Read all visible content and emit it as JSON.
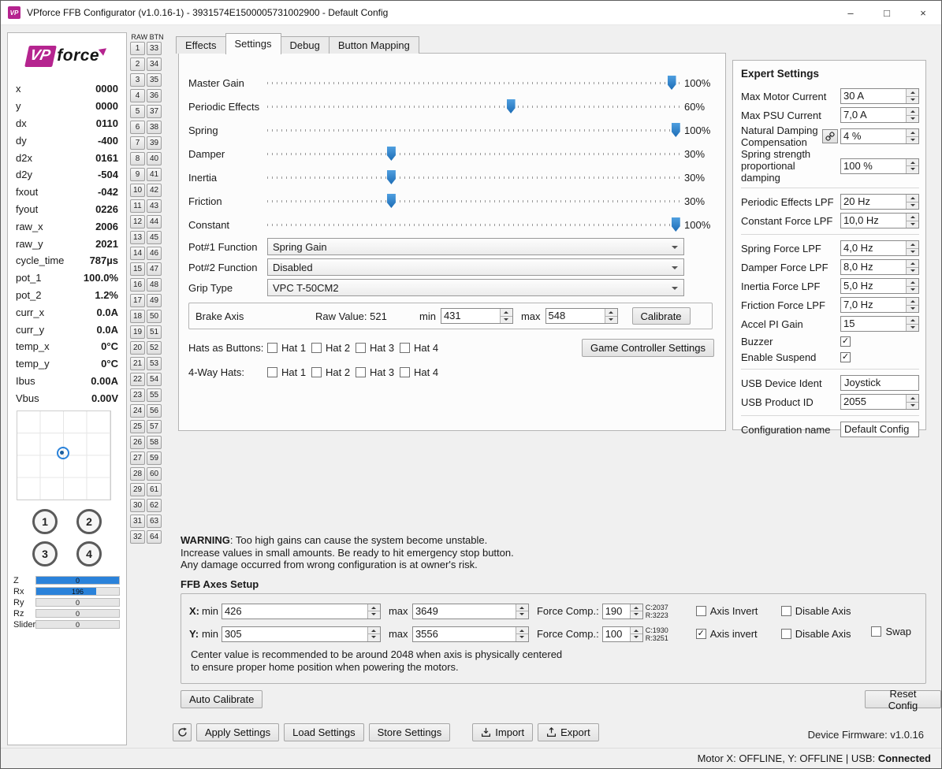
{
  "colors": {
    "accent_blue": "#2a82da",
    "brand_magenta": "#b5248f",
    "slider_handle_blue": "#1c6cb5"
  },
  "window": {
    "icon_text": "VP",
    "title": "VPforce FFB Configurator (v1.0.16-1) - 3931574E1500005731002900 - Default Config",
    "minimize_glyph": "–",
    "maximize_glyph": "□",
    "close_glyph": "×"
  },
  "sidebar": {
    "logo_vp": "VP",
    "logo_force": "force",
    "telemetry": [
      {
        "label": "x",
        "value": "0000"
      },
      {
        "label": "y",
        "value": "0000"
      },
      {
        "label": "dx",
        "value": "0110"
      },
      {
        "label": "dy",
        "value": "-400"
      },
      {
        "label": "d2x",
        "value": "0161"
      },
      {
        "label": "d2y",
        "value": "-504"
      },
      {
        "label": "fxout",
        "value": "-042"
      },
      {
        "label": "fyout",
        "value": "0226"
      },
      {
        "label": "raw_x",
        "value": "2006"
      },
      {
        "label": "raw_y",
        "value": "2021"
      },
      {
        "label": "cycle_time",
        "value": "787µs"
      },
      {
        "label": "pot_1",
        "value": "100.0%"
      },
      {
        "label": "pot_2",
        "value": "1.2%"
      },
      {
        "label": "curr_x",
        "value": "0.0A"
      },
      {
        "label": "curr_y",
        "value": "0.0A"
      },
      {
        "label": "temp_x",
        "value": "0°C"
      },
      {
        "label": "temp_y",
        "value": "0°C"
      },
      {
        "label": "Ibus",
        "value": "0.00A"
      },
      {
        "label": "Vbus",
        "value": "0.00V"
      }
    ],
    "round_buttons": [
      "1",
      "2",
      "3",
      "4"
    ],
    "axis_bars": [
      {
        "label": "Z",
        "value": "0",
        "fill": 100
      },
      {
        "label": "Rx",
        "value": "196",
        "fill": 72
      },
      {
        "label": "Ry",
        "value": "0",
        "fill": 0
      },
      {
        "label": "Rz",
        "value": "0",
        "fill": 0
      },
      {
        "label": "Slider",
        "value": "0",
        "fill": 0
      }
    ]
  },
  "raw_btn": {
    "header": "RAW BTN",
    "rows": 32
  },
  "tabs": [
    {
      "label": "Effects",
      "active": false
    },
    {
      "label": "Settings",
      "active": true
    },
    {
      "label": "Debug",
      "active": false
    },
    {
      "label": "Button Mapping",
      "active": false
    }
  ],
  "settings": {
    "sliders": [
      {
        "label": "Master Gain",
        "value": "100%",
        "pos": 98
      },
      {
        "label": "Periodic Effects",
        "value": "60%",
        "pos": 59
      },
      {
        "label": "Spring",
        "value": "100%",
        "pos": 99
      },
      {
        "label": "Damper",
        "value": "30%",
        "pos": 30
      },
      {
        "label": "Inertia",
        "value": "30%",
        "pos": 30
      },
      {
        "label": "Friction",
        "value": "30%",
        "pos": 30
      },
      {
        "label": "Constant",
        "value": "100%",
        "pos": 99
      }
    ],
    "selects": [
      {
        "label": "Pot#1 Function",
        "value": "Spring Gain"
      },
      {
        "label": "Pot#2 Function",
        "value": "Disabled"
      },
      {
        "label": "Grip Type",
        "value": "VPC T-50CM2"
      }
    ],
    "brake": {
      "label": "Brake Axis",
      "raw_value": "Raw Value: 521",
      "min_label": "min",
      "min": "431",
      "max_label": "max",
      "max": "548",
      "calibrate": "Calibrate"
    },
    "hats_as_buttons": {
      "label": "Hats as Buttons:",
      "items": [
        "Hat 1",
        "Hat 2",
        "Hat 3",
        "Hat 4"
      ]
    },
    "four_way_hats": {
      "label": "4-Way Hats:",
      "items": [
        "Hat 1",
        "Hat 2",
        "Hat 3",
        "Hat 4"
      ]
    },
    "game_controller_button": "Game Controller Settings"
  },
  "expert": {
    "title": "Expert Settings",
    "rows": [
      {
        "label": "Max Motor Current",
        "type": "spin",
        "value": "30 A"
      },
      {
        "label": "Max PSU Current",
        "type": "spin",
        "value": "7,0 A"
      },
      {
        "label": "Natural Damping Compensation",
        "type": "spin",
        "value": "4 %",
        "link": true
      },
      {
        "label": "Spring strength proportional damping",
        "type": "spin",
        "value": "100 %",
        "sep_after": true
      },
      {
        "label": "Periodic Effects LPF",
        "type": "spin",
        "value": "20 Hz"
      },
      {
        "label": "Constant Force LPF",
        "type": "spin",
        "value": "10,0 Hz",
        "sep_after": true
      },
      {
        "label": "Spring Force LPF",
        "type": "spin",
        "value": "4,0 Hz"
      },
      {
        "label": "Damper Force LPF",
        "type": "spin",
        "value": "8,0 Hz"
      },
      {
        "label": "Inertia Force LPF",
        "type": "spin",
        "value": "5,0 Hz"
      },
      {
        "label": "Friction Force LPF",
        "type": "spin",
        "value": "7,0 Hz"
      },
      {
        "label": "Accel PI Gain",
        "type": "spin",
        "value": "15"
      },
      {
        "label": "Buzzer",
        "type": "check",
        "checked": true
      },
      {
        "label": "Enable Suspend",
        "type": "check",
        "checked": true,
        "sep_after": true
      },
      {
        "label": "USB Device Ident",
        "type": "text",
        "value": "Joystick"
      },
      {
        "label": "USB Product ID",
        "type": "spin",
        "value": "2055",
        "sep_after": true
      },
      {
        "label": "Configuration name",
        "type": "text",
        "value": "Default Config"
      }
    ]
  },
  "warning": {
    "title": "WARNING",
    "line1": ": Too high gains can cause the system become unstable.",
    "line2": "Increase values in small amounts. Be ready to hit emergency stop button.",
    "line3": "Any damage occurred from wrong configuration is at owner's risk."
  },
  "ffb_axes": {
    "title": "FFB Axes Setup",
    "rows": [
      {
        "axis": "X:",
        "min_label": "min",
        "min": "426",
        "max_label": "max",
        "max": "3649",
        "fc_label": "Force Comp.:",
        "fc": "190",
        "center": "C:2037",
        "raw": "R:3223",
        "invert_label": "Axis Invert",
        "invert": false,
        "disable_label": "Disable Axis",
        "disable": false
      },
      {
        "axis": "Y:",
        "min_label": "min",
        "min": "305",
        "max_label": "max",
        "max": "3556",
        "fc_label": "Force Comp.:",
        "fc": "100",
        "center": "C:1930",
        "raw": "R:3251",
        "invert_label": "Axis invert",
        "invert": true,
        "disable_label": "Disable Axis",
        "disable": false
      }
    ],
    "swap_label": "Swap",
    "note_line1": "Center value is recommended to be around 2048 when axis is physically centered",
    "note_line2": "to ensure proper home position when powering the motors."
  },
  "actions": {
    "auto_calibrate": "Auto Calibrate",
    "reset_config": "Reset Config",
    "apply": "Apply Settings",
    "load": "Load Settings",
    "store": "Store Settings",
    "import": "Import",
    "export": "Export",
    "firmware": "Device Firmware: v1.0.16"
  },
  "statusbar": {
    "motor_text": "Motor X: OFFLINE, Y: OFFLINE | USB: ",
    "usb_status": "Connected"
  }
}
